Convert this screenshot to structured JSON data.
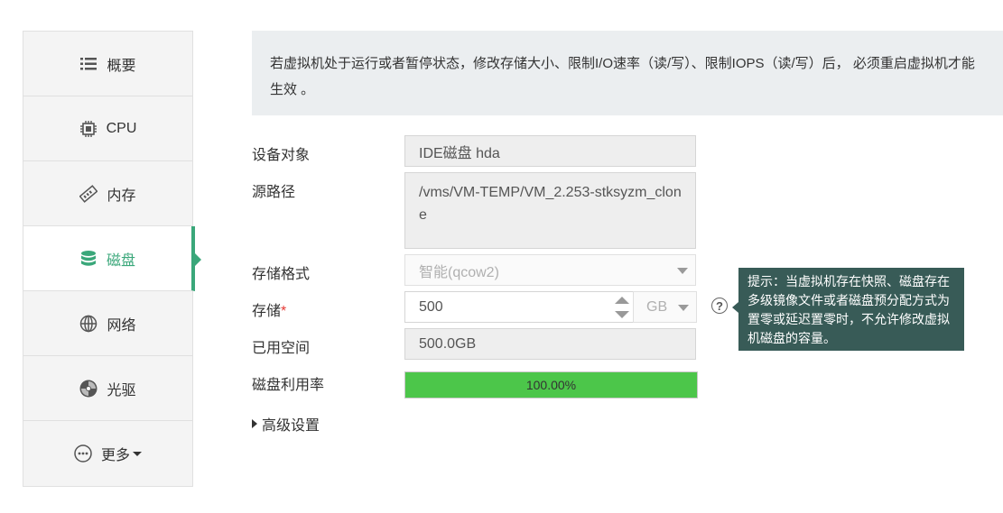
{
  "sidebar": {
    "items": [
      {
        "label": "概要",
        "icon": "list-icon"
      },
      {
        "label": "CPU",
        "icon": "cpu-chip-icon"
      },
      {
        "label": "内存",
        "icon": "memory-stick-icon"
      },
      {
        "label": "磁盘",
        "icon": "database-icon",
        "active": true
      },
      {
        "label": "网络",
        "icon": "globe-icon"
      },
      {
        "label": "光驱",
        "icon": "disc-icon"
      },
      {
        "label": "更多",
        "icon": "more-dots-icon",
        "dropdown": true
      }
    ],
    "accent_color": "#3aa77a"
  },
  "notice": {
    "text": "若虚拟机处于运行或者暂停状态，修改存储大小、限制I/O速率（读/写）、限制IOPS（读/写）后， 必须重启虚拟机才能生效 。"
  },
  "form": {
    "device": {
      "label": "设备对象",
      "value": "IDE磁盘 hda"
    },
    "source_path": {
      "label": "源路径",
      "value": "/vms/VM-TEMP/VM_2.253-stksyzm_clone"
    },
    "storage_format": {
      "label": "存储格式",
      "value": "智能(qcow2)"
    },
    "storage": {
      "label": "存储",
      "required_mark": "*",
      "value": "500",
      "unit": "GB"
    },
    "used_space": {
      "label": "已用空间",
      "value": "500.0GB"
    },
    "disk_usage": {
      "label": "磁盘利用率",
      "value_text": "100.00%",
      "percent": 100,
      "bar_color": "#4cc64a"
    },
    "advanced": {
      "label": "高级设置"
    }
  },
  "tooltip": {
    "help_symbol": "?",
    "text": "提示：当虚拟机存在快照、磁盘存在多级镜像文件或者磁盘预分配方式为置零或延迟置零时，不允许修改虚拟机磁盘的容量。",
    "bg_color": "#385b57"
  }
}
